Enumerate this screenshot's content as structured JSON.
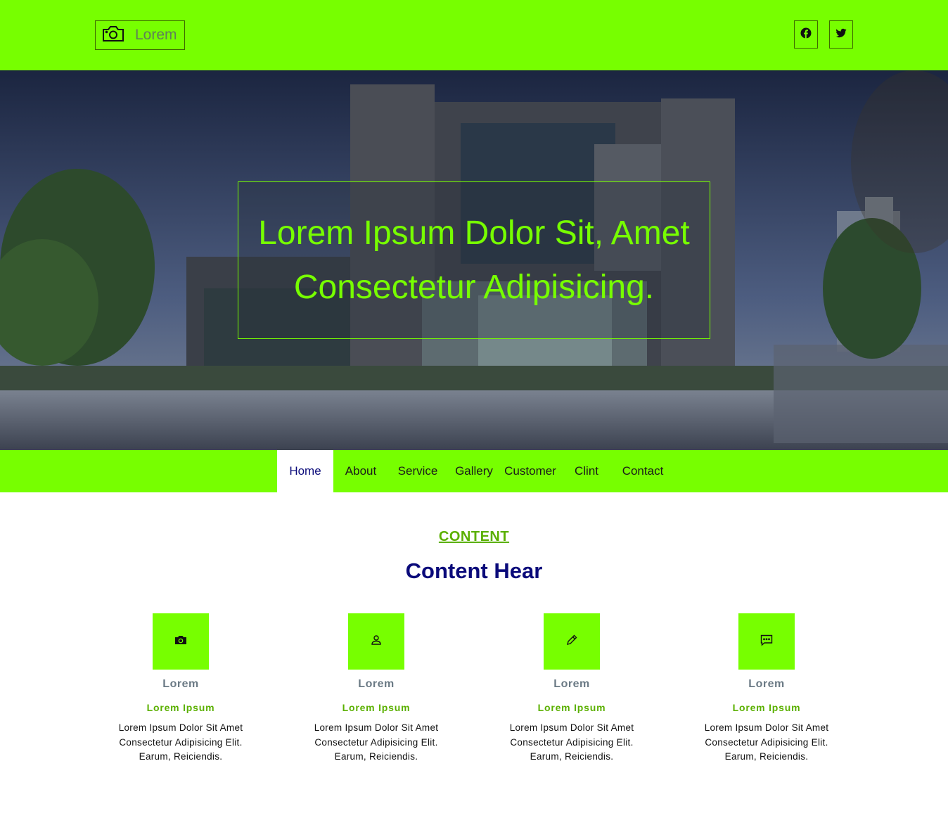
{
  "header": {
    "logo": {
      "icon": "camera-icon",
      "text": "Lorem"
    },
    "social": [
      {
        "name": "facebook-icon"
      },
      {
        "name": "twitter-icon"
      }
    ]
  },
  "hero": {
    "title": "Lorem Ipsum Dolor Sit, Amet Consectetur Adipisicing."
  },
  "nav": {
    "items": [
      {
        "label": "Home",
        "active": true
      },
      {
        "label": "About"
      },
      {
        "label": "Service"
      },
      {
        "label": "Gallery"
      },
      {
        "label": "Customer"
      },
      {
        "label": "Clint"
      },
      {
        "label": "Contact"
      }
    ]
  },
  "section": {
    "kicker": "CONTENT",
    "heading": "Content Hear",
    "cards": [
      {
        "icon": "camera-icon",
        "title": "Lorem",
        "subtitle": "Lorem Ipsum",
        "text": "Lorem Ipsum Dolor Sit Amet Consectetur Adipisicing Elit. Earum, Reiciendis."
      },
      {
        "icon": "user-icon",
        "title": "Lorem",
        "subtitle": "Lorem Ipsum",
        "text": "Lorem Ipsum Dolor Sit Amet Consectetur Adipisicing Elit. Earum, Reiciendis."
      },
      {
        "icon": "pencil-icon",
        "title": "Lorem",
        "subtitle": "Lorem Ipsum",
        "text": "Lorem Ipsum Dolor Sit Amet Consectetur Adipisicing Elit. Earum, Reiciendis."
      },
      {
        "icon": "chat-icon",
        "title": "Lorem",
        "subtitle": "Lorem Ipsum",
        "text": "Lorem Ipsum Dolor Sit Amet Consectetur Adipisicing Elit. Earum, Reiciendis."
      }
    ]
  },
  "colors": {
    "accent": "#77ff00",
    "heading": "#0a0a7a",
    "kicker": "#5bb000"
  }
}
